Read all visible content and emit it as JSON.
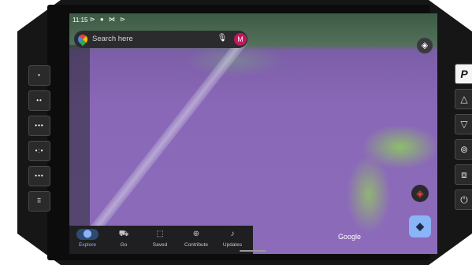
{
  "status": {
    "time": "11:15",
    "icons": "⊳ ● ⋈ ⊳"
  },
  "search": {
    "placeholder": "Search here",
    "avatar_initial": "M"
  },
  "map": {
    "attribution": "Google"
  },
  "bottom_nav": [
    {
      "label": "Explore",
      "icon": "location-pin-icon",
      "glyph": "⬤"
    },
    {
      "label": "Go",
      "icon": "commute-icon",
      "glyph": "⛟"
    },
    {
      "label": "Saved",
      "icon": "bookmark-icon",
      "glyph": "⬚"
    },
    {
      "label": "Contribute",
      "icon": "add-circle-icon",
      "glyph": "⊕"
    },
    {
      "label": "Updates",
      "icon": "bell-icon",
      "glyph": "♪"
    }
  ],
  "left_buttons": [
    "•",
    "••",
    "•••",
    "•:•",
    "•••",
    "⠿"
  ],
  "right_buttons": [
    "P",
    "△",
    "▽",
    "⊚",
    "⧈",
    "⏻"
  ],
  "colors": {
    "accent": "#8ab4f8",
    "avatar_bg": "#c2185b",
    "nav_bg": "#1f1f22"
  }
}
